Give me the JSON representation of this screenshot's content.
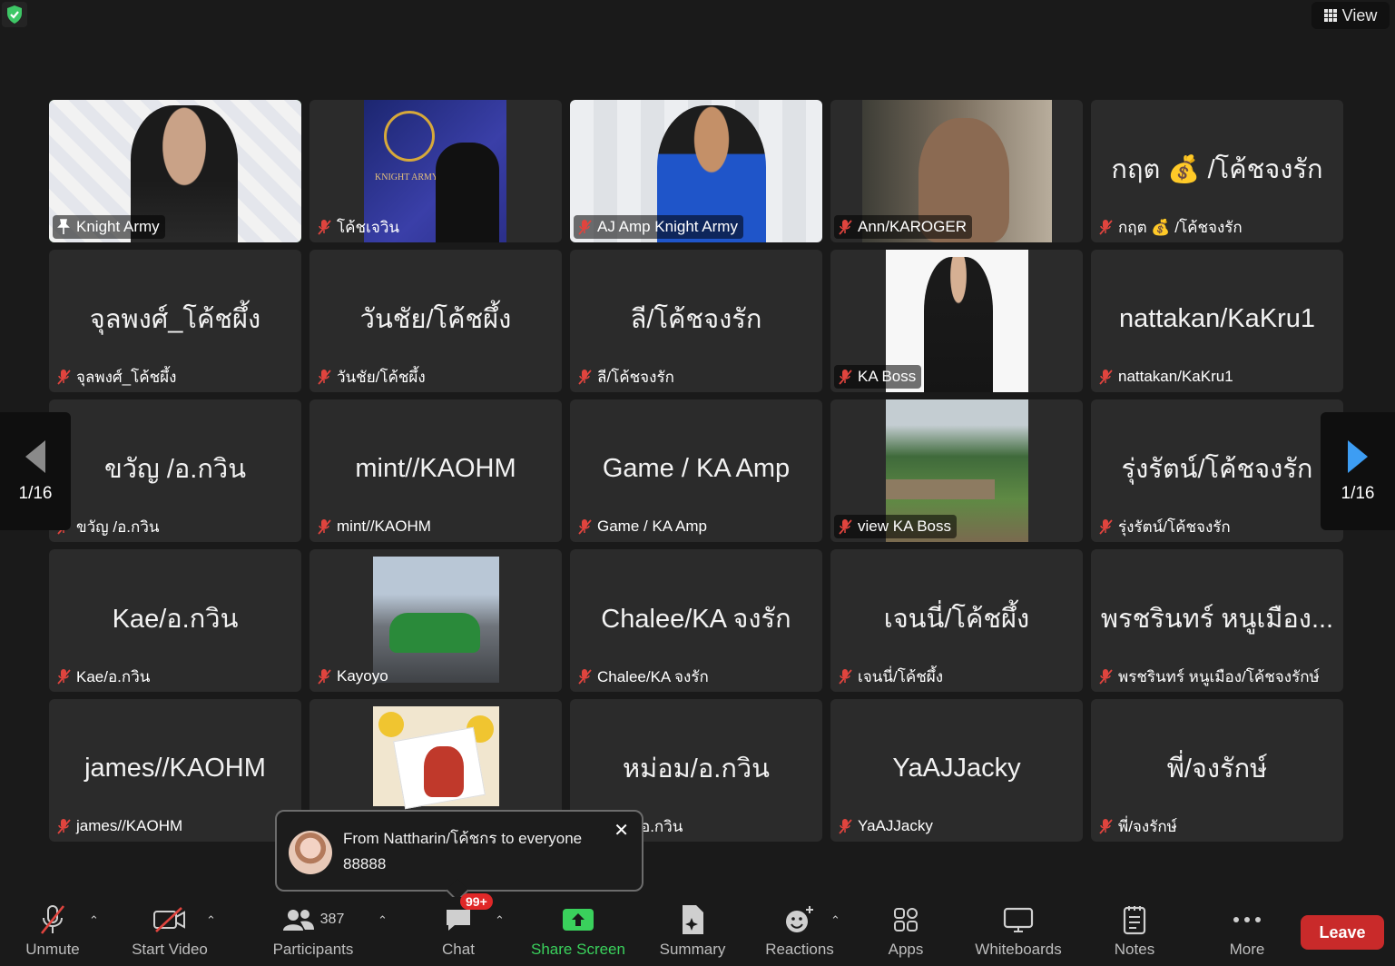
{
  "top": {
    "view_label": "View"
  },
  "pagination": {
    "left_page": "1/16",
    "right_page": "1/16"
  },
  "tiles": [
    {
      "big": "",
      "label": "Knight Army"
    },
    {
      "big": "",
      "label": "โค้ชเจวิน"
    },
    {
      "big": "",
      "label": "AJ Amp Knight Army"
    },
    {
      "big": "",
      "label": "Ann/KAROGER"
    },
    {
      "big": "กฤต 💰 /โค้ชจงรัก",
      "label": "กฤต 💰 /โค้ชจงรัก"
    },
    {
      "big": "จุลพงศ์_โค้ชผึ้ง",
      "label": "จุลพงศ์_โค้ชผึ้ง"
    },
    {
      "big": "วันชัย/โค้ชผึ้ง",
      "label": "วันชัย/โค้ชผึ้ง"
    },
    {
      "big": "ลี/โค้ชจงรัก",
      "label": "ลี/โค้ชจงรัก"
    },
    {
      "big": "",
      "label": "KA Boss"
    },
    {
      "big": "nattakan/KaKru1",
      "label": "nattakan/KaKru1"
    },
    {
      "big": "ขวัญ /อ.กวิน",
      "label": "ขวัญ /อ.กวิน"
    },
    {
      "big": "mint//KAOHM",
      "label": "mint//KAOHM"
    },
    {
      "big": "Game / KA Amp",
      "label": "Game / KA Amp"
    },
    {
      "big": "",
      "label": "view KA Boss"
    },
    {
      "big": "รุ่งรัตน์/โค้ชจงรัก",
      "label": "รุ่งรัตน์/โค้ชจงรัก"
    },
    {
      "big": "Kae/อ.กวิน",
      "label": "Kae/อ.กวิน"
    },
    {
      "big": "",
      "label": "Kayoyo"
    },
    {
      "big": "Chalee/KA จงรัก",
      "label": "Chalee/KA จงรัก"
    },
    {
      "big": "เจนนี่/โค้ชผึ้ง",
      "label": "เจนนี่/โค้ชผึ้ง"
    },
    {
      "big": "พรชรินทร์ หนูเมือง...",
      "label": "พรชรินทร์ หนูเมือง/โค้ชจงรักษ์"
    },
    {
      "big": "james//KAOHM",
      "label": "james//KAOHM"
    },
    {
      "big": "",
      "label": ""
    },
    {
      "big": "หม่อม/อ.กวิน",
      "label": "อ.กวิน"
    },
    {
      "big": "YaAJJacky",
      "label": "YaAJJacky"
    },
    {
      "big": "พี่/จงรักษ์",
      "label": "พี่/จงรักษ์"
    }
  ],
  "coach_logo_text": "KNIGHT ARMY",
  "toast": {
    "from": "From Nattharin/โค้ชกร to everyone",
    "message": "88888",
    "close": "✕"
  },
  "toolbar": {
    "unmute": "Unmute",
    "start_video": "Start Video",
    "participants": "Participants",
    "participant_count": "387",
    "chat": "Chat",
    "chat_badge": "99+",
    "share_screen": "Share Screen",
    "summary": "Summary",
    "reactions": "Reactions",
    "apps": "Apps",
    "whiteboards": "Whiteboards",
    "notes": "Notes",
    "more": "More",
    "leave": "Leave"
  },
  "colors": {
    "active_speaker": "#4bd160",
    "share_green": "#3ad15c",
    "leave_red": "#c92a2a",
    "badge_red": "#e02828",
    "nav_arrow_blue": "#3d9df3"
  }
}
